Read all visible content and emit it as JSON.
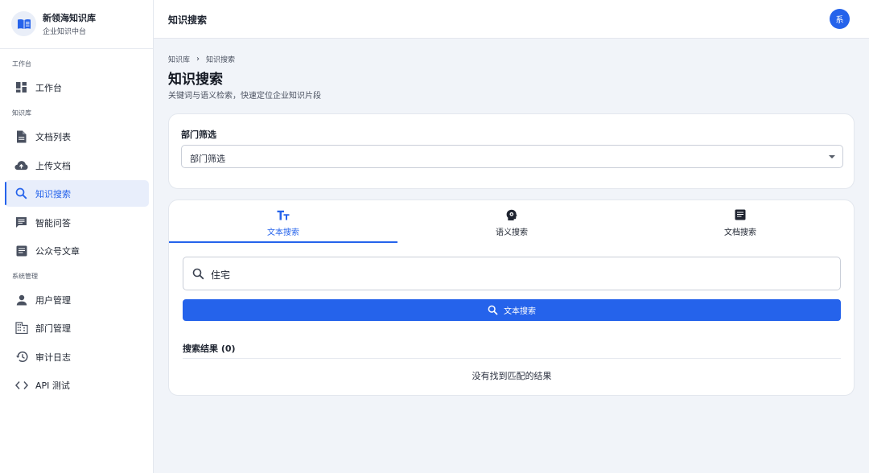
{
  "brand": {
    "name": "新领海知识库",
    "subtitle": "企业知识中台"
  },
  "sidebar": {
    "sections": [
      "工作台",
      "知识库",
      "系统管理"
    ],
    "items": [
      {
        "label": "工作台",
        "icon": "dashboard-icon"
      },
      {
        "label": "文档列表",
        "icon": "document-icon"
      },
      {
        "label": "上传文档",
        "icon": "cloud-upload-icon"
      },
      {
        "label": "知识搜索",
        "icon": "search-icon",
        "active": true
      },
      {
        "label": "智能问答",
        "icon": "chat-icon"
      },
      {
        "label": "公众号文章",
        "icon": "article-icon"
      },
      {
        "label": "用户管理",
        "icon": "person-icon"
      },
      {
        "label": "部门管理",
        "icon": "building-icon"
      },
      {
        "label": "审计日志",
        "icon": "history-icon"
      },
      {
        "label": "API 测试",
        "icon": "code-icon"
      }
    ]
  },
  "header": {
    "title": "知识搜索",
    "avatar_text": "系"
  },
  "breadcrumb": [
    "知识库",
    "知识搜索"
  ],
  "page": {
    "title": "知识搜索",
    "subtitle": "关键词与语义检索，快速定位企业知识片段"
  },
  "filter": {
    "label": "部门筛选",
    "selected": "部门筛选"
  },
  "tabs": [
    {
      "label": "文本搜索",
      "icon": "text-format-icon",
      "active": true
    },
    {
      "label": "语义搜索",
      "icon": "brain-head-icon"
    },
    {
      "label": "文档搜索",
      "icon": "article-icon"
    }
  ],
  "search": {
    "value": "住宅",
    "button_label": "文本搜索"
  },
  "results": {
    "title": "搜索结果 (0)",
    "empty_text": "没有找到匹配的结果"
  },
  "colors": {
    "accent": "#2563eb",
    "background": "#f1f4f9",
    "active_nav_bg": "#e8eefb"
  }
}
